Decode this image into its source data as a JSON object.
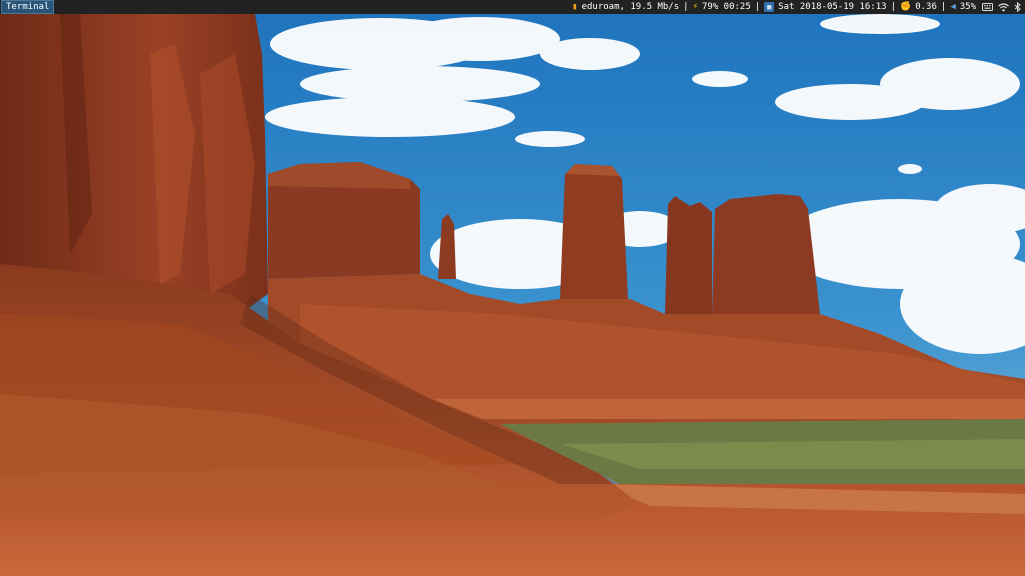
{
  "workspace": {
    "label": "Terminal"
  },
  "status": {
    "network_icon": "wifi-icon",
    "network": "eduroam, 19.5 Mb/s",
    "battery_icon": "lightning-icon",
    "battery": "79% 00:25",
    "clock_icon": "calendar-icon",
    "clock": "Sat 2018-05-19 16:13",
    "load_icon": "flexed-arm-icon",
    "load": "0.36",
    "volume_icon": "speaker-icon",
    "volume": "35%",
    "separator": "|"
  },
  "tray": [
    "keyboard-icon",
    "wifi-tray-icon",
    "bluetooth-icon"
  ],
  "colors": {
    "bar_bg": "#222222",
    "workspace_bg": "#285577",
    "workspace_border": "#4c7899",
    "sky": "#2a7fc0",
    "rock": "#8a3a20",
    "sand": "#c0643a"
  }
}
